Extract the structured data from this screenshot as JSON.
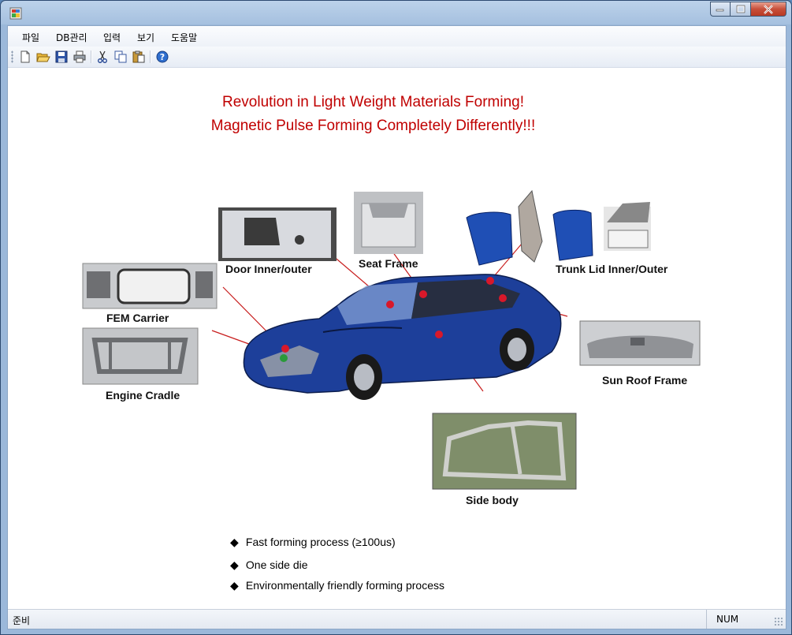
{
  "window": {
    "title": ""
  },
  "menu": [
    "파일",
    "DB관리",
    "입력",
    "보기",
    "도움말"
  ],
  "toolbar": {
    "icons": [
      "new-icon",
      "open-icon",
      "save-icon",
      "print-icon",
      "cut-icon",
      "copy-icon",
      "paste-icon",
      "help-icon"
    ]
  },
  "content": {
    "headline1": "Revolution in Light Weight Materials Forming!",
    "headline2": "Magnetic Pulse Forming Completely Differently!!!",
    "headline_color": "#c00000",
    "parts": {
      "door": "Door Inner/outer",
      "seat": "Seat Frame",
      "trunk": "Trunk Lid Inner/Outer",
      "fem": "FEM Carrier",
      "engine": "Engine Cradle",
      "sunroof": "Sun Roof Frame",
      "side": "Side body"
    },
    "bullets": [
      "Fast forming process (≥100us)",
      "One side die",
      "Environmentally friendly forming process"
    ]
  },
  "status": {
    "left": "준비",
    "num": "NUM"
  }
}
